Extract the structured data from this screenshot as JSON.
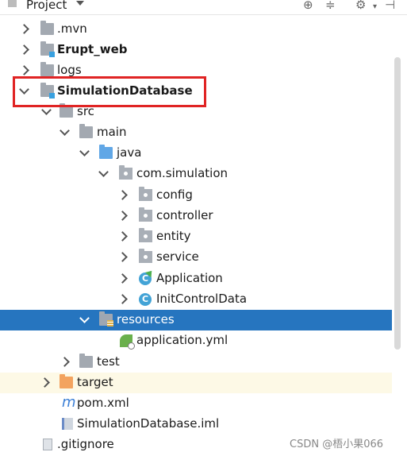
{
  "header": {
    "title": "Project",
    "icons": [
      "target-icon",
      "collapse-all-icon",
      "gear-icon",
      "hide-panel-icon"
    ]
  },
  "tree": {
    "nodes": [
      {
        "label": "SimulationDatabase",
        "bold": true,
        "expanded": true,
        "highlighted": true
      },
      {
        "label": ".mvn",
        "icon": "folder-icon"
      },
      {
        "label": "Erupt_web",
        "icon": "module-folder-icon",
        "bold": true
      },
      {
        "label": "logs",
        "icon": "folder-icon"
      },
      {
        "label": "src",
        "icon": "folder-icon"
      },
      {
        "label": "main",
        "icon": "folder-icon"
      },
      {
        "label": "java",
        "icon": "source-folder-icon"
      },
      {
        "label": "com.simulation",
        "icon": "package-icon"
      },
      {
        "label": "config",
        "icon": "package-icon"
      },
      {
        "label": "controller",
        "icon": "package-icon"
      },
      {
        "label": "entity",
        "icon": "package-icon"
      },
      {
        "label": "service",
        "icon": "package-icon"
      },
      {
        "label": "Application",
        "icon": "spring-boot-class-icon"
      },
      {
        "label": "InitControlData",
        "icon": "class-icon"
      },
      {
        "label": "resources",
        "icon": "resources-folder-icon",
        "selected": true
      },
      {
        "label": "application.yml",
        "icon": "spring-config-icon"
      },
      {
        "label": "test",
        "icon": "folder-icon"
      },
      {
        "label": "target",
        "icon": "excluded-folder-icon"
      },
      {
        "label": "pom.xml",
        "icon": "maven-icon"
      },
      {
        "label": "SimulationDatabase.iml",
        "icon": "iml-file-icon"
      },
      {
        "label": ".gitignore",
        "icon": "file-icon"
      }
    ]
  },
  "watermark": "CSDN @梧小果066",
  "colors": {
    "selection": "#2675bf",
    "highlight_box": "#e02424",
    "excluded_row": "#fdf9e6"
  }
}
